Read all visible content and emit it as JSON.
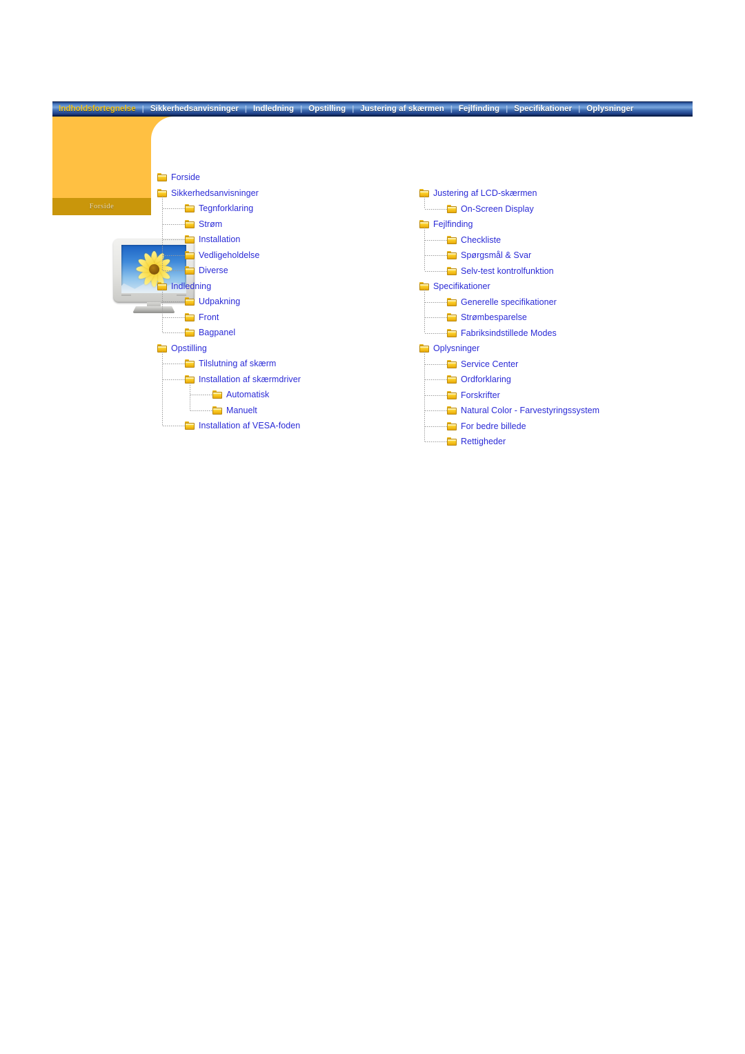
{
  "navbar": {
    "separator": "|",
    "items": [
      {
        "label": "Indholdsfortegnelse",
        "active": true
      },
      {
        "label": "Sikkerhedsanvisninger",
        "active": false
      },
      {
        "label": "Indledning",
        "active": false
      },
      {
        "label": "Opstilling",
        "active": false
      },
      {
        "label": "Justering af skærmen",
        "active": false
      },
      {
        "label": "Fejlfinding",
        "active": false
      },
      {
        "label": "Specifikationer",
        "active": false
      },
      {
        "label": "Oplysninger",
        "active": false
      }
    ]
  },
  "cover": {
    "label": "Forside",
    "image_alt": "monitor-with-sunflower"
  },
  "tree_left": [
    {
      "label": "Forside",
      "level": 0
    },
    {
      "label": "Sikkerhedsanvisninger",
      "level": 0
    },
    {
      "label": "Tegnforklaring",
      "level": 1
    },
    {
      "label": "Strøm",
      "level": 1
    },
    {
      "label": "Installation",
      "level": 1
    },
    {
      "label": "Vedligeholdelse",
      "level": 1
    },
    {
      "label": "Diverse",
      "level": 1
    },
    {
      "label": "Indledning",
      "level": 0
    },
    {
      "label": "Udpakning",
      "level": 1
    },
    {
      "label": "Front",
      "level": 1
    },
    {
      "label": "Bagpanel",
      "level": 1
    },
    {
      "label": "Opstilling",
      "level": 0
    },
    {
      "label": "Tilslutning af skærm",
      "level": 1
    },
    {
      "label": "Installation af skærmdriver",
      "level": 1
    },
    {
      "label": "Automatisk",
      "level": 2
    },
    {
      "label": "Manuelt",
      "level": 2
    },
    {
      "label": "Installation af VESA-foden",
      "level": 1
    }
  ],
  "tree_right": [
    {
      "label": "Justering af LCD-skærmen",
      "level": 0
    },
    {
      "label": "On-Screen Display",
      "level": 1
    },
    {
      "label": "Fejlfinding",
      "level": 0
    },
    {
      "label": "Checkliste",
      "level": 1
    },
    {
      "label": "Spørgsmål & Svar",
      "level": 1
    },
    {
      "label": "Selv-test kontrolfunktion",
      "level": 1
    },
    {
      "label": "Specifikationer",
      "level": 0
    },
    {
      "label": "Generelle specifikationer",
      "level": 1
    },
    {
      "label": "Strømbesparelse",
      "level": 1
    },
    {
      "label": "Fabriksindstillede Modes",
      "level": 1
    },
    {
      "label": "Oplysninger",
      "level": 0
    },
    {
      "label": "Service Center",
      "level": 1
    },
    {
      "label": "Ordforklaring",
      "level": 1
    },
    {
      "label": "Forskrifter",
      "level": 1
    },
    {
      "label": "Natural Color - Farvestyringssystem",
      "level": 1
    },
    {
      "label": "For bedre billede",
      "level": 1
    },
    {
      "label": "Rettigheder",
      "level": 1
    }
  ],
  "colors": {
    "nav_active_text": "#f2c31a",
    "nav_text": "#ffffff",
    "nav_gradient_top": "#4f7fc4",
    "nav_gradient_bottom": "#132c63",
    "cover_orange": "#ffc042",
    "cover_band": "#c9960b",
    "link_blue": "#2929d6",
    "folder_yellow": "#fbcf2a",
    "page_background": "#ffffff"
  }
}
